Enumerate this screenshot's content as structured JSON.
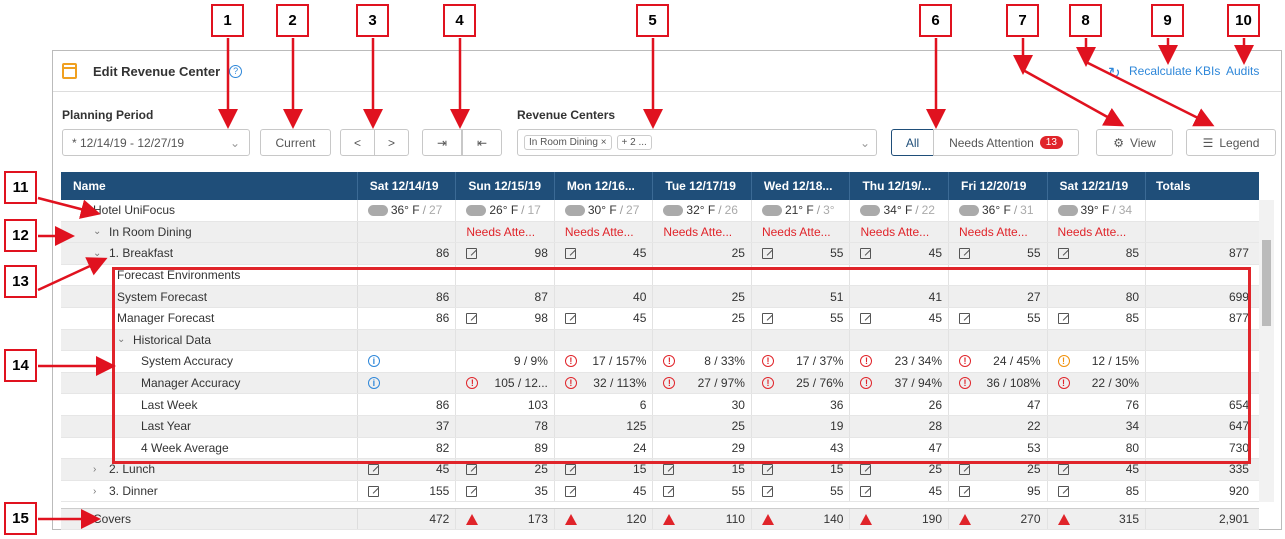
{
  "callouts": [
    "1",
    "2",
    "3",
    "4",
    "5",
    "6",
    "7",
    "8",
    "9",
    "10",
    "11",
    "12",
    "13",
    "14",
    "15"
  ],
  "header": {
    "title": "Edit Revenue Center",
    "help": "?",
    "recalc": "Recalculate KBIs",
    "audits": "Audits"
  },
  "toolbar": {
    "planning_label": "Planning Period",
    "period_value": "* 12/14/19 - 12/27/19",
    "current": "Current",
    "prev": "<",
    "next": ">",
    "revenue_label": "Revenue Centers",
    "chip1": "In Room Dining ×",
    "chip2": "+ 2 ...",
    "all": "All",
    "needs_attention": "Needs Attention",
    "na_count": "13",
    "view": "View",
    "legend": "Legend"
  },
  "columns": [
    "Name",
    "Sat 12/14/19",
    "Sun 12/15/19",
    "Mon 12/16...",
    "Tue 12/17/19",
    "Wed 12/18...",
    "Thu 12/19/...",
    "Fri 12/20/19",
    "Sat 12/21/19",
    "Totals"
  ],
  "hotel": "Hotel UniFocus",
  "weather": [
    {
      "hi": "36° F",
      "lo": "27"
    },
    {
      "hi": "26° F",
      "lo": "17"
    },
    {
      "hi": "30° F",
      "lo": "27"
    },
    {
      "hi": "32° F",
      "lo": "26"
    },
    {
      "hi": "21° F",
      "lo": "3°"
    },
    {
      "hi": "34° F",
      "lo": "22"
    },
    {
      "hi": "36° F",
      "lo": "31"
    },
    {
      "hi": "39° F",
      "lo": "34"
    }
  ],
  "in_room": "In Room Dining",
  "needs_att_short": "Needs Atte...",
  "rows": [
    {
      "name": "1. Breakfast",
      "indent": 1,
      "caret": "v",
      "vals": [
        "86",
        "98",
        "45",
        "25",
        "55",
        "45",
        "55",
        "85"
      ],
      "icons": [
        "",
        "pen",
        "pen",
        "",
        "pen",
        "pen",
        "pen",
        "pen"
      ],
      "total": "877"
    },
    {
      "name": "Forecast Environments",
      "indent": 2,
      "vals": [
        "",
        "",
        "",
        "",
        "",
        "",
        "",
        ""
      ],
      "icons": [
        "",
        "",
        "",
        "",
        "",
        "",
        "",
        ""
      ],
      "total": ""
    },
    {
      "name": "System Forecast",
      "indent": 2,
      "vals": [
        "86",
        "87",
        "40",
        "25",
        "51",
        "41",
        "27",
        "80"
      ],
      "icons": [
        "",
        "",
        "",
        "",
        "",
        "",
        "",
        ""
      ],
      "total": "699"
    },
    {
      "name": "Manager Forecast",
      "indent": 2,
      "vals": [
        "86",
        "98",
        "45",
        "25",
        "55",
        "45",
        "55",
        "85"
      ],
      "icons": [
        "",
        "pen",
        "pen",
        "",
        "pen",
        "pen",
        "pen",
        "pen"
      ],
      "total": "877"
    },
    {
      "name": "Historical Data",
      "indent": 2,
      "caret": "v",
      "vals": [
        "",
        "",
        "",
        "",
        "",
        "",
        "",
        ""
      ],
      "icons": [
        "",
        "",
        "",
        "",
        "",
        "",
        "",
        ""
      ],
      "total": ""
    },
    {
      "name": "System Accuracy",
      "indent": 3,
      "vals": [
        "",
        "9 / 9%",
        "17 / 157%",
        "8 / 33%",
        "17 / 37%",
        "23 / 34%",
        "24 / 45%",
        "12 / 15%"
      ],
      "icons": [
        "info",
        "",
        "err",
        "err",
        "err",
        "err",
        "err",
        "warn"
      ],
      "total": ""
    },
    {
      "name": "Manager Accuracy",
      "indent": 3,
      "vals": [
        "",
        "105 / 12...",
        "32 / 113%",
        "27 / 97%",
        "25 / 76%",
        "37 / 94%",
        "36 / 108%",
        "22 / 30%"
      ],
      "icons": [
        "info",
        "err",
        "err",
        "err",
        "err",
        "err",
        "err",
        "err"
      ],
      "total": ""
    },
    {
      "name": "Last Week",
      "indent": 3,
      "vals": [
        "86",
        "103",
        "6",
        "30",
        "36",
        "26",
        "47",
        "76"
      ],
      "icons": [
        "",
        "",
        "",
        "",
        "",
        "",
        "",
        ""
      ],
      "total": "654"
    },
    {
      "name": "Last Year",
      "indent": 3,
      "vals": [
        "37",
        "78",
        "125",
        "25",
        "19",
        "28",
        "22",
        "34"
      ],
      "icons": [
        "",
        "",
        "",
        "",
        "",
        "",
        "",
        ""
      ],
      "total": "647"
    },
    {
      "name": "4 Week Average",
      "indent": 3,
      "vals": [
        "82",
        "89",
        "24",
        "29",
        "43",
        "47",
        "53",
        "80"
      ],
      "icons": [
        "",
        "",
        "",
        "",
        "",
        "",
        "",
        ""
      ],
      "total": "730"
    },
    {
      "name": "2. Lunch",
      "indent": 1,
      "caret": ">",
      "vals": [
        "45",
        "25",
        "15",
        "15",
        "15",
        "25",
        "25",
        "45"
      ],
      "icons": [
        "pen",
        "pen",
        "pen",
        "pen",
        "pen",
        "pen",
        "pen",
        "pen"
      ],
      "total": "335"
    },
    {
      "name": "3. Dinner",
      "indent": 1,
      "caret": ">",
      "vals": [
        "155",
        "35",
        "45",
        "55",
        "55",
        "45",
        "95",
        "85"
      ],
      "icons": [
        "pen",
        "pen",
        "pen",
        "pen",
        "pen",
        "pen",
        "pen",
        "pen"
      ],
      "total": "920"
    }
  ],
  "covers": {
    "name": "Covers",
    "vals": [
      "472",
      "173",
      "120",
      "110",
      "140",
      "190",
      "270",
      "315"
    ],
    "icons": [
      "",
      "tri",
      "tri",
      "tri",
      "tri",
      "tri",
      "tri",
      "tri"
    ],
    "total": "2,901"
  }
}
